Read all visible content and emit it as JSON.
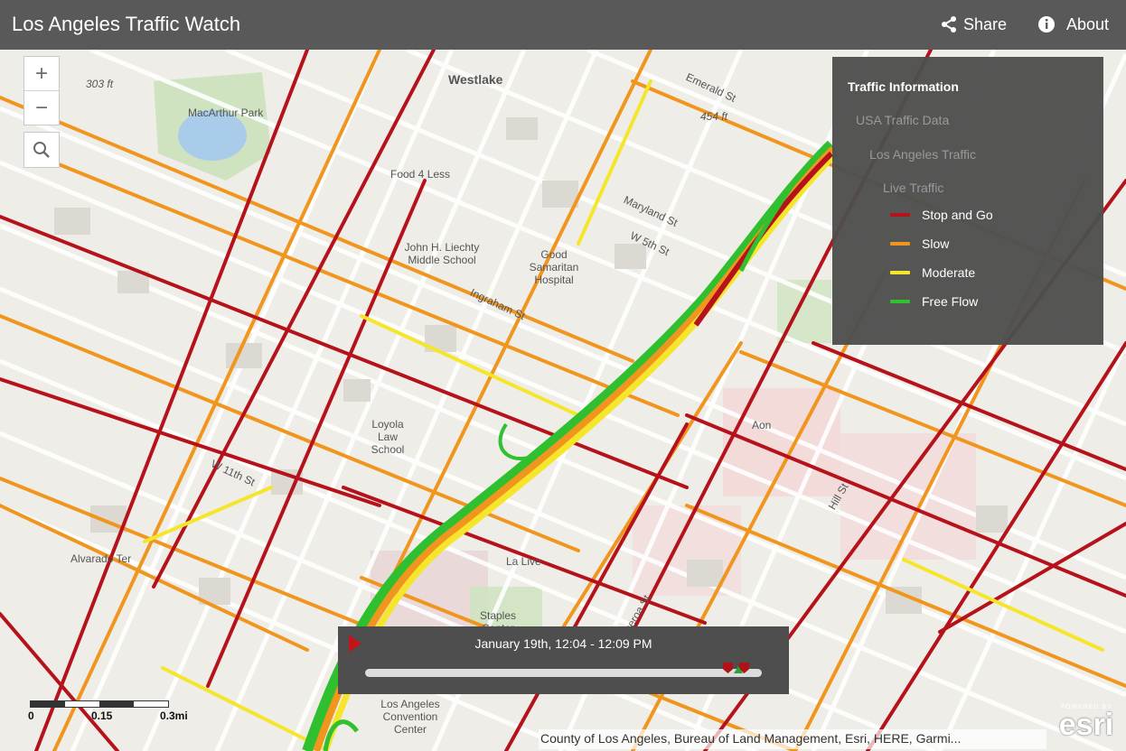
{
  "header": {
    "title": "Los Angeles Traffic Watch",
    "share_label": "Share",
    "about_label": "About"
  },
  "map": {
    "zoom_in": "+",
    "zoom_out": "−",
    "labels": [
      "Westlake",
      "MacArthur Park",
      "303 ft",
      "454 ft",
      "Food 4 Less",
      "John H. Liechty Middle School",
      "Good Samaritan Hospital",
      "Loyola Law School",
      "La Live",
      "Staples Center",
      "Los Angeles Convention Center",
      "Aon",
      "Alvarado Ter",
      "Emerald St",
      "Maryland St",
      "Ingraham St",
      "W 5th St",
      "Hill St",
      "Figueroa St",
      "W 11th St"
    ],
    "scale_labels": [
      "0",
      "0.15",
      "0.3mi"
    ],
    "attribution": "County of Los Angeles, Bureau of Land Management, Esri, HERE, Garmi...",
    "esri_powered": "POWERED BY",
    "esri_logo": "esri"
  },
  "legend": {
    "title": "Traffic Information",
    "level1": "USA Traffic Data",
    "level2": "Los Angeles Traffic",
    "level3": "Live Traffic",
    "items": [
      {
        "label": "Stop and Go",
        "color": "#b5121b"
      },
      {
        "label": "Slow",
        "color": "#f0961e"
      },
      {
        "label": "Moderate",
        "color": "#f5e52b"
      },
      {
        "label": "Free Flow",
        "color": "#30c030"
      }
    ]
  },
  "time_slider": {
    "label": "January 19th, 12:04 - 12:09 PM",
    "position": 0.96
  },
  "colors": {
    "header_bg": "#595959",
    "panel_bg": "#4e4e4e",
    "play": "#c0161a"
  }
}
